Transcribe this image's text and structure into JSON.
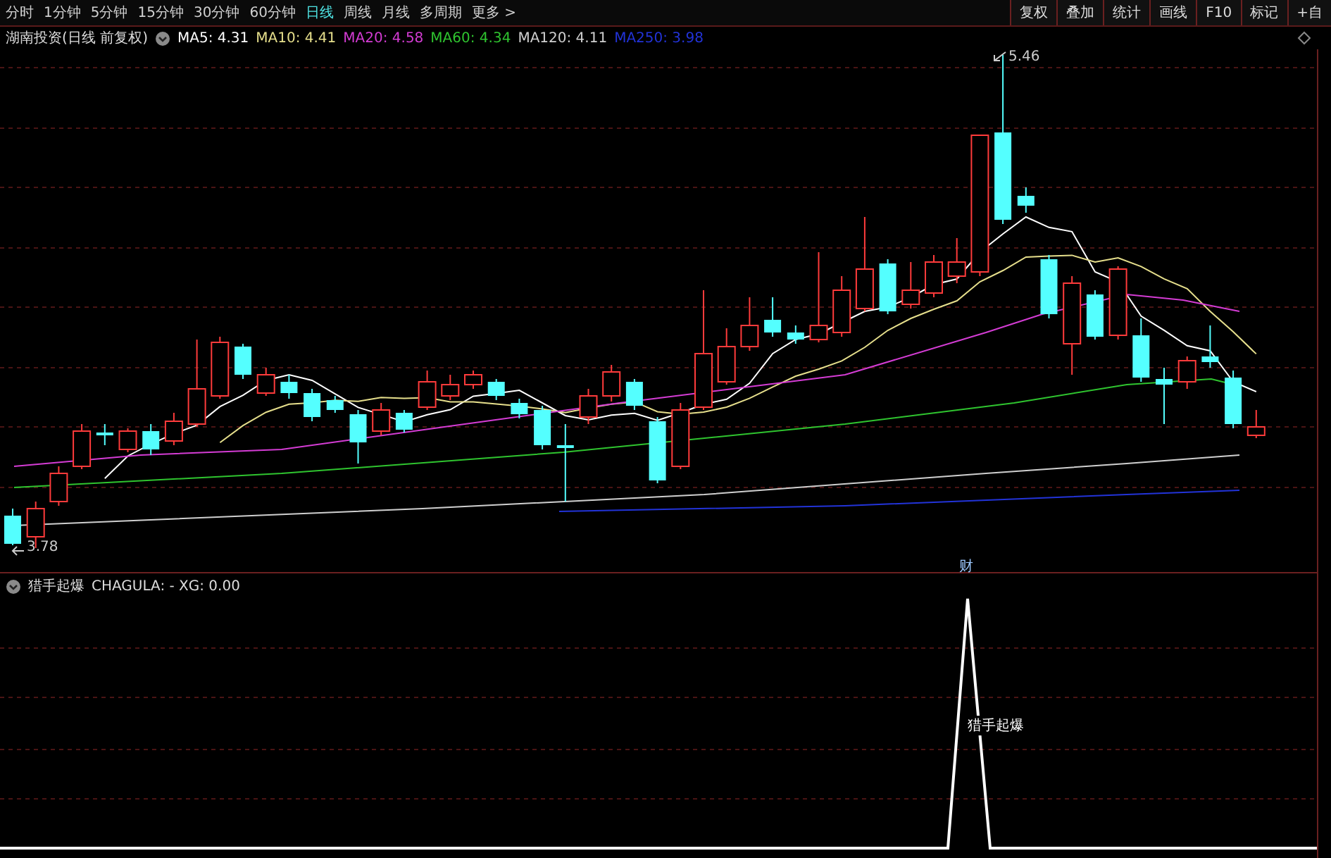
{
  "toolbar": {
    "periods": [
      {
        "label": "分时",
        "selected": false
      },
      {
        "label": "1分钟",
        "selected": false
      },
      {
        "label": "5分钟",
        "selected": false
      },
      {
        "label": "15分钟",
        "selected": false
      },
      {
        "label": "30分钟",
        "selected": false
      },
      {
        "label": "60分钟",
        "selected": false
      },
      {
        "label": "日线",
        "selected": true
      },
      {
        "label": "周线",
        "selected": false
      },
      {
        "label": "月线",
        "selected": false
      },
      {
        "label": "多周期",
        "selected": false
      },
      {
        "label": "更多 >",
        "selected": false
      }
    ],
    "actions": [
      "复权",
      "叠加",
      "统计",
      "画线",
      "F10",
      "标记",
      "+自"
    ]
  },
  "legend": {
    "title": "湖南投资(日线 前复权)",
    "averages": [
      {
        "label": "MA5: 4.31",
        "color": "#ffffff"
      },
      {
        "label": "MA10: 4.41",
        "color": "#e6df8c"
      },
      {
        "label": "MA20: 4.58",
        "color": "#d43cd4"
      },
      {
        "label": "MA60: 4.34",
        "color": "#2fc42f"
      },
      {
        "label": "MA120: 4.11",
        "color": "#cfcfcf"
      },
      {
        "label": "MA250: 3.98",
        "color": "#2233d8"
      }
    ]
  },
  "price_chart": {
    "high_label": "5.46",
    "low_label": "3.78"
  },
  "indicator": {
    "name": "猎手起爆",
    "readout": "CHAGULA: -  XG: 0.00",
    "marker": "财",
    "signal_label": "猎手起爆"
  }
}
